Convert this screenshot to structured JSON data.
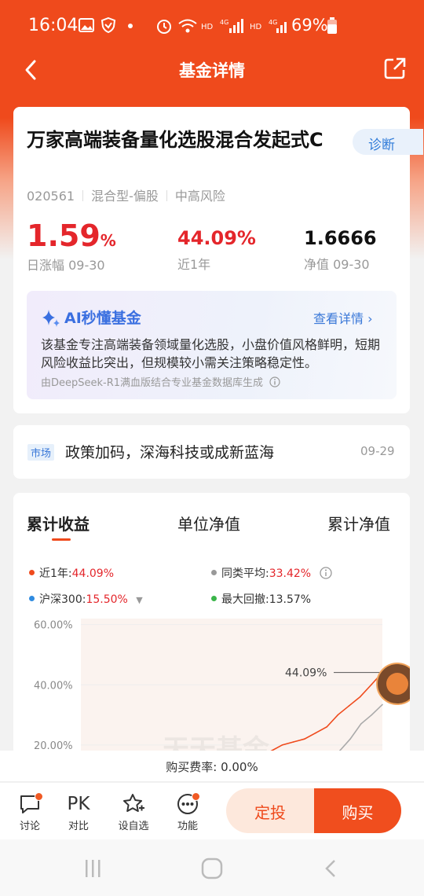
{
  "status_bar": {
    "time": "16:04",
    "battery": "69%"
  },
  "header": {
    "title": "基金详情"
  },
  "fund": {
    "name": "万家高端装备量化选股混合发起式C",
    "diagnose_label": "诊断",
    "code": "020561",
    "type": "混合型-偏股",
    "risk": "中高风险",
    "daily_change_value": "1.59",
    "daily_change_unit": "%",
    "daily_change_label": "日涨幅 09-30",
    "year_return": "44.09%",
    "year_return_label": "近1年",
    "nav": "1.6666",
    "nav_label": "净值 09-30"
  },
  "ai": {
    "title": "AI秒懂基金",
    "more": "查看详情",
    "text": "该基金专注高端装备领域量化选股，小盘价值风格鲜明，短期风险收益比突出，但规模较小需关注策略稳定性。",
    "footer": "由DeepSeek-R1满血版结合专业基金数据库生成"
  },
  "news": {
    "tag": "市场",
    "text": "政策加码，深海科技或成新蓝海",
    "date": "09-29"
  },
  "chart": {
    "tabs": [
      "累计收益",
      "单位净值",
      "累计净值"
    ],
    "legend": [
      {
        "label": "近1年:",
        "value": "44.09%",
        "color": "#ef4a1c"
      },
      {
        "label": "同类平均:",
        "value": "33.42%",
        "color": "#999999"
      },
      {
        "label": "沪深300:",
        "value": "15.50%",
        "color": "#2f8be0"
      },
      {
        "label": "最大回撤:",
        "value": "13.57%",
        "color": "#3bb54a"
      }
    ],
    "callout": "44.09%",
    "watermark": "天天基金"
  },
  "chart_data": {
    "type": "line",
    "ytick_labels": [
      "60.00%",
      "40.00%",
      "20.00%"
    ],
    "series": [
      {
        "name": "近1年",
        "values": [
          14,
          16,
          18,
          20,
          21,
          22,
          24,
          26,
          30,
          33,
          36,
          40,
          44.09
        ]
      },
      {
        "name": "同类平均",
        "values": [
          7,
          8,
          10,
          11,
          12,
          14,
          16,
          18,
          22,
          27,
          30,
          33.42
        ]
      }
    ],
    "ylim": [
      15,
      62
    ]
  },
  "fee": {
    "text": "购买费率: 0.00%"
  },
  "bottom": {
    "items": [
      {
        "label": "讨论"
      },
      {
        "label": "对比",
        "glyph": "PK"
      },
      {
        "label": "设自选"
      },
      {
        "label": "功能"
      }
    ],
    "dingtou": "定投",
    "buy": "购买"
  },
  "colors": {
    "brand": "#ef4a1c",
    "red": "#e4262b",
    "blue": "#3a78d8"
  }
}
